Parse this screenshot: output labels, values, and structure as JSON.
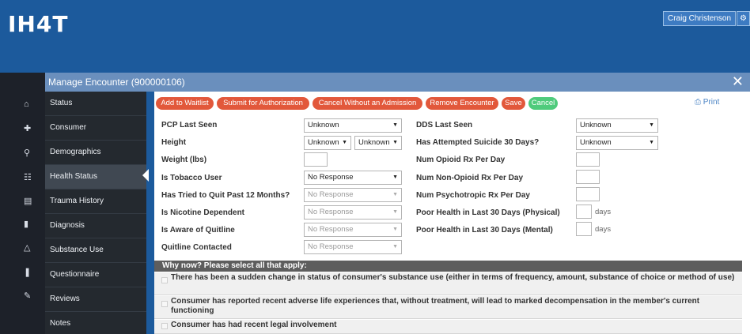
{
  "header": {
    "logo_text": "IH4T",
    "user_name": "Craig Christenson",
    "settings_icon": "gear-icon"
  },
  "left_rail": {
    "icons": [
      "home-icon",
      "plus-icon",
      "search-icon",
      "briefcase-icon",
      "chart-icon",
      "document-icon",
      "bell-icon",
      "pipe-icon",
      "clipboard-icon"
    ]
  },
  "modal": {
    "title": "Manage Encounter (900000106)",
    "close_icon": "close-icon"
  },
  "sidenav": {
    "items": [
      {
        "label": "Status"
      },
      {
        "label": "Consumer"
      },
      {
        "label": "Demographics"
      },
      {
        "label": "Health Status"
      },
      {
        "label": "Trauma History"
      },
      {
        "label": "Diagnosis"
      },
      {
        "label": "Substance Use"
      },
      {
        "label": "Questionnaire"
      },
      {
        "label": "Reviews"
      },
      {
        "label": "Notes"
      }
    ],
    "active": "Health Status"
  },
  "toolbar": {
    "add_waitlist": "Add to Waitlist",
    "submit_auth": "Submit for Authorization",
    "cancel_no_admission": "Cancel Without an Admission",
    "remove_encounter": "Remove Encounter",
    "save": "Save",
    "cancel": "Cancel",
    "print": "Print"
  },
  "form": {
    "pcp_last_seen": {
      "label": "PCP Last Seen",
      "value": "Unknown"
    },
    "height": {
      "label": "Height",
      "feet": "Unknown",
      "inches": "Unknown"
    },
    "weight": {
      "label": "Weight (lbs)",
      "value": ""
    },
    "tobacco_user": {
      "label": "Is Tobacco User",
      "value": "No Response"
    },
    "tried_quit": {
      "label": "Has Tried to Quit Past 12 Months?",
      "value": "No Response"
    },
    "nicotine_dependent": {
      "label": "Is Nicotine Dependent",
      "value": "No Response"
    },
    "aware_quitline": {
      "label": "Is Aware of Quitline",
      "value": "No Response"
    },
    "quitline_contacted": {
      "label": "Quitline Contacted",
      "value": "No Response"
    },
    "dds_last_seen": {
      "label": "DDS Last Seen",
      "value": "Unknown"
    },
    "attempted_suicide": {
      "label": "Has Attempted Suicide 30 Days?",
      "value": "Unknown"
    },
    "opioid_rx": {
      "label": "Num Opioid Rx Per Day",
      "value": ""
    },
    "nonopioid_rx": {
      "label": "Num Non-Opioid Rx Per Day",
      "value": ""
    },
    "psychotropic_rx": {
      "label": "Num Psychotropic Rx Per Day",
      "value": ""
    },
    "poor_physical": {
      "label": "Poor Health in Last 30 Days (Physical)",
      "value": "",
      "unit": "days"
    },
    "poor_mental": {
      "label": "Poor Health in Last 30 Days (Mental)",
      "value": "",
      "unit": "days"
    }
  },
  "why_now": {
    "heading": "Why now? Please select all that apply:",
    "options": [
      {
        "text": "There has been a sudden change in status of consumer's substance use (either in terms of frequency, amount, substance of choice or method of use)",
        "checked": false
      },
      {
        "text": "Consumer has reported recent adverse life experiences that, without treatment, will lead to marked decompensation in the member's current functioning",
        "checked": false
      },
      {
        "text": "Consumer has had recent legal involvement",
        "checked": false
      }
    ]
  }
}
